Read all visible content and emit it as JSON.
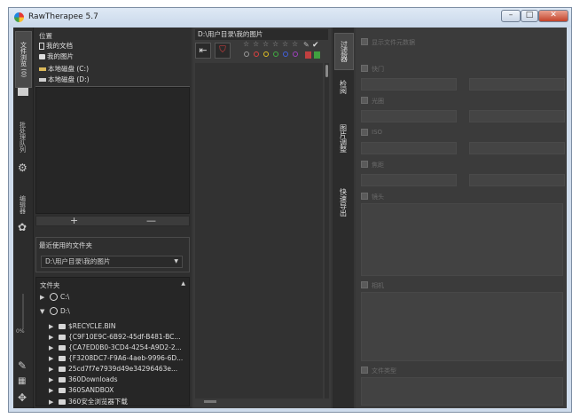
{
  "window": {
    "title": "RawTherapee 5.7",
    "minimize_icon": "minimize-icon",
    "maximize_icon": "maximize-icon",
    "close_icon": "close-icon"
  },
  "left_vtabs": {
    "file_browser": "文件浏览 (0)",
    "batch_queue": "批处理队列",
    "editor": "编辑器"
  },
  "places": {
    "title": "位置",
    "items": [
      {
        "label": "我的文档",
        "icon": "document-icon"
      },
      {
        "label": "我的图片",
        "icon": "camera-icon"
      },
      {
        "label": "本地磁盘 (C:)",
        "icon": "drive-icon"
      },
      {
        "label": "本地磁盘 (D:)",
        "icon": "drive-icon"
      }
    ],
    "add": "+",
    "remove": "—"
  },
  "recent": {
    "title": "最近使用的文件夹",
    "selected": "D:\\用户目录\\我的图片"
  },
  "folders": {
    "title": "文件夹",
    "collapse_symbol": "▲",
    "drives": [
      "C:\\",
      "D:\\"
    ],
    "items": [
      "$RECYCLE.BIN",
      "{C9F10E9C-6B92-45df-B481-BC...",
      "{CA7ED0B0-3CD4-4254-A9D2-2...",
      "{F3208DC7-F9A6-4aeb-9996-6D...",
      "25cd7f7e7939d49e34296463e...",
      "360Downloads",
      "360SANDBOX",
      "360安全浏览器下载"
    ]
  },
  "left_misc": {
    "zoom_percent": "0%"
  },
  "center": {
    "path": "D:\\用户目录\\我的图片",
    "star_count": 5,
    "label_colors": [
      "#e04040",
      "#e0c020",
      "#40b040",
      "#4060e0",
      "#a040c0"
    ]
  },
  "right_vtabs": {
    "filter": "过滤器",
    "inspect": "检阅",
    "image_adjust": "图片调整",
    "quick_export": "快速导出"
  },
  "filter_panel": {
    "sections": [
      {
        "label": "显示文件元数据"
      },
      {
        "label": "快门"
      },
      {
        "label": "光圈"
      },
      {
        "label": "ISO"
      },
      {
        "label": "焦距"
      },
      {
        "label": "镜头"
      },
      {
        "label": "相机"
      },
      {
        "label": "文件类型"
      }
    ]
  }
}
